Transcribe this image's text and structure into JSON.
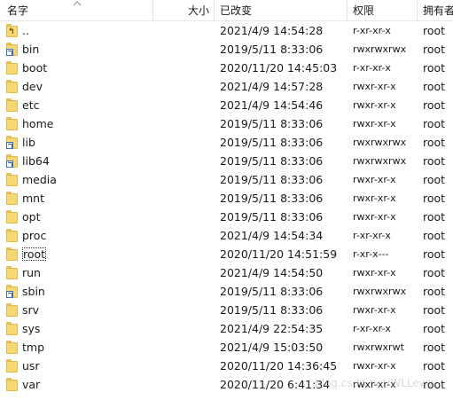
{
  "columns": {
    "name": "名字",
    "size": "大小",
    "modified": "已改变",
    "permissions": "权限",
    "owner": "拥有者"
  },
  "files": [
    {
      "name": "..",
      "date": "2021/4/9 14:54:28",
      "perm": "r-xr-xr-x",
      "owner": "root",
      "icon": "parent-folder-icon"
    },
    {
      "name": "bin",
      "date": "2019/5/11 8:33:06",
      "perm": "rwxrwxrwx",
      "owner": "root",
      "icon": "folder-shortcut-icon"
    },
    {
      "name": "boot",
      "date": "2020/11/20 14:45:03",
      "perm": "r-xr-xr-x",
      "owner": "root",
      "icon": "folder-icon"
    },
    {
      "name": "dev",
      "date": "2021/4/9 14:57:28",
      "perm": "rwxr-xr-x",
      "owner": "root",
      "icon": "folder-icon"
    },
    {
      "name": "etc",
      "date": "2021/4/9 14:54:46",
      "perm": "rwxr-xr-x",
      "owner": "root",
      "icon": "folder-icon"
    },
    {
      "name": "home",
      "date": "2019/5/11 8:33:06",
      "perm": "rwxr-xr-x",
      "owner": "root",
      "icon": "folder-icon"
    },
    {
      "name": "lib",
      "date": "2019/5/11 8:33:06",
      "perm": "rwxrwxrwx",
      "owner": "root",
      "icon": "folder-shortcut-icon"
    },
    {
      "name": "lib64",
      "date": "2019/5/11 8:33:06",
      "perm": "rwxrwxrwx",
      "owner": "root",
      "icon": "folder-shortcut-icon"
    },
    {
      "name": "media",
      "date": "2019/5/11 8:33:06",
      "perm": "rwxr-xr-x",
      "owner": "root",
      "icon": "folder-icon"
    },
    {
      "name": "mnt",
      "date": "2019/5/11 8:33:06",
      "perm": "rwxr-xr-x",
      "owner": "root",
      "icon": "folder-icon"
    },
    {
      "name": "opt",
      "date": "2019/5/11 8:33:06",
      "perm": "rwxr-xr-x",
      "owner": "root",
      "icon": "folder-icon"
    },
    {
      "name": "proc",
      "date": "2021/4/9 14:54:34",
      "perm": "r-xr-xr-x",
      "owner": "root",
      "icon": "folder-icon"
    },
    {
      "name": "root",
      "date": "2020/11/20 14:51:59",
      "perm": "r-xr-x---",
      "owner": "root",
      "icon": "folder-icon",
      "focused": true
    },
    {
      "name": "run",
      "date": "2021/4/9 14:54:50",
      "perm": "rwxr-xr-x",
      "owner": "root",
      "icon": "folder-icon"
    },
    {
      "name": "sbin",
      "date": "2019/5/11 8:33:06",
      "perm": "rwxrwxrwx",
      "owner": "root",
      "icon": "folder-shortcut-icon"
    },
    {
      "name": "srv",
      "date": "2019/5/11 8:33:06",
      "perm": "rwxr-xr-x",
      "owner": "root",
      "icon": "folder-icon"
    },
    {
      "name": "sys",
      "date": "2021/4/9 22:54:35",
      "perm": "r-xr-xr-x",
      "owner": "root",
      "icon": "folder-icon"
    },
    {
      "name": "tmp",
      "date": "2021/4/9 15:03:50",
      "perm": "rwxrwxrwt",
      "owner": "root",
      "icon": "folder-icon"
    },
    {
      "name": "usr",
      "date": "2020/11/20 14:36:45",
      "perm": "rwxr-xr-x",
      "owner": "root",
      "icon": "folder-icon"
    },
    {
      "name": "var",
      "date": "2020/11/20 6:41:34",
      "perm": "rwxr-xr-x",
      "owner": "root",
      "icon": "folder-icon"
    }
  ],
  "watermark": "blog.csdn.net/WLLeww"
}
